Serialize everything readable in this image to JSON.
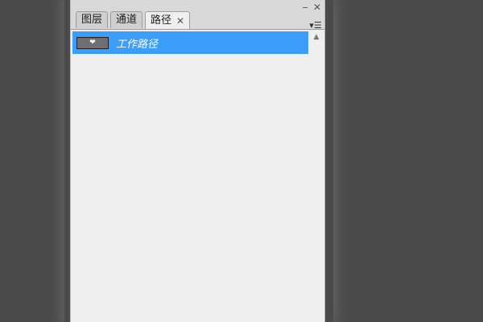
{
  "window": {
    "minimize_icon": "minimize-icon",
    "close_icon": "close-icon",
    "minimize_glyph": "‒",
    "close_glyph": "✕"
  },
  "tabs": [
    {
      "label": "图层",
      "active": false
    },
    {
      "label": "通道",
      "active": false
    },
    {
      "label": "路径",
      "active": true,
      "close_glyph": "✕"
    }
  ],
  "panel_menu": {
    "icon": "panel-menu-icon",
    "glyph": "▾☰"
  },
  "paths": [
    {
      "label": "工作路径",
      "selected": true,
      "thumbnail_glyph": "❤"
    }
  ],
  "scrollbar": {
    "up_glyph": "▲"
  },
  "colors": {
    "selection": "#3d9dfb",
    "panel_bg": "#efefef",
    "desktop_bg": "#4a4a4a"
  }
}
